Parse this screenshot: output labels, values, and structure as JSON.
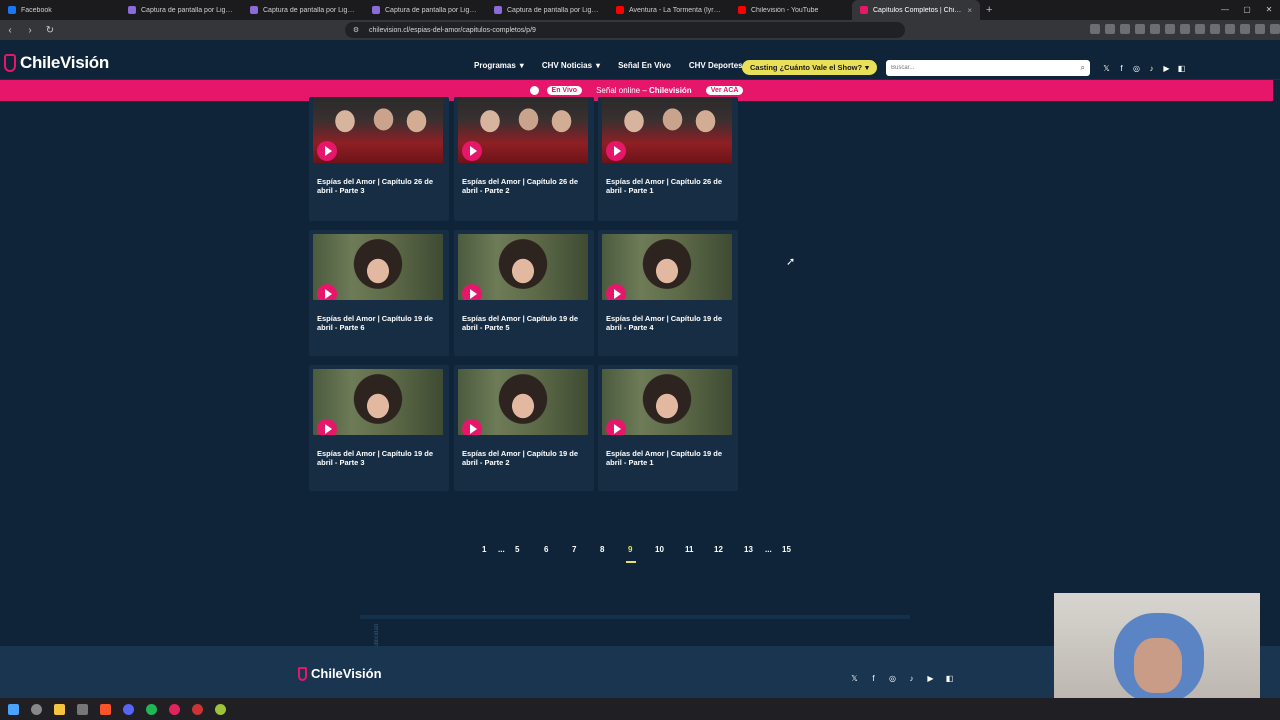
{
  "browser": {
    "tabs": [
      {
        "label": "Facebook",
        "color": "#1877f2",
        "active": false,
        "x": 0
      },
      {
        "label": "Captura de pantalla por Lightshot",
        "color": "#8a6bd8",
        "active": false
      },
      {
        "label": "Captura de pantalla por Lightshot",
        "color": "#8a6bd8",
        "active": false
      },
      {
        "label": "Captura de pantalla por Lightshot",
        "color": "#8a6bd8",
        "active": false
      },
      {
        "label": "Captura de pantalla por Lightshot",
        "color": "#8a6bd8",
        "active": false
      },
      {
        "label": "Aventura - La Tormenta (lyric - le",
        "color": "#ff0000",
        "active": false
      },
      {
        "label": "Chilevisión - YouTube",
        "color": "#ff0000",
        "active": false
      },
      {
        "label": "Capítulos Completos | Chilevisió",
        "color": "#e6176b",
        "active": true
      }
    ],
    "new_tab": "+",
    "url": "chilevision.cl/espias-del-amor/capitulos-completos/p/9"
  },
  "site": {
    "logo_text": "ChileVisión",
    "nav": [
      {
        "label": "Programas",
        "dropdown": true
      },
      {
        "label": "CHV Noticias",
        "dropdown": true
      },
      {
        "label": "Señal En Vivo",
        "dropdown": false
      },
      {
        "label": "CHV Deportes",
        "dropdown": false
      }
    ],
    "casting_label": "Casting ¿Cuánto Vale el Show?",
    "search_placeholder": "Buscar...",
    "social_icons": [
      "x-icon",
      "facebook-icon",
      "instagram-icon",
      "tiktok-icon",
      "youtube-icon",
      "twitch-icon"
    ]
  },
  "live_bar": {
    "badge": "En Vivo",
    "text": "Señal online – ",
    "channel": "Chilevisión",
    "cta": "Ver ACÁ"
  },
  "episodes": [
    {
      "title": "Espías del Amor | Capítulo 26 de abril - Parte 3",
      "thumb": "red"
    },
    {
      "title": "Espías del Amor | Capítulo 26 de abril - Parte 2",
      "thumb": "red"
    },
    {
      "title": "Espías del Amor | Capítulo 26 de abril - Parte 1",
      "thumb": "red"
    },
    {
      "title": "Espías del Amor | Capítulo 19 de abril - Parte 6",
      "thumb": "green"
    },
    {
      "title": "Espías del Amor | Capítulo 19 de abril - Parte 5",
      "thumb": "green"
    },
    {
      "title": "Espías del Amor | Capítulo 19 de abril - Parte 4",
      "thumb": "green"
    },
    {
      "title": "Espías del Amor | Capítulo 19 de abril - Parte 3",
      "thumb": "green"
    },
    {
      "title": "Espías del Amor | Capítulo 19 de abril - Parte 2",
      "thumb": "green"
    },
    {
      "title": "Espías del Amor | Capítulo 19 de abril - Parte 1",
      "thumb": "green"
    }
  ],
  "pagination": {
    "items": [
      "1",
      "...",
      "5",
      "6",
      "7",
      "8",
      "9",
      "10",
      "11",
      "12",
      "13",
      "...",
      "15"
    ],
    "current": "9"
  },
  "ad_label": "Publicidad",
  "footer": {
    "logo_text": "ChileVisión"
  },
  "colors": {
    "brand_pink": "#e6176b",
    "background": "#0f2438",
    "accent_yellow": "#e9e05a"
  }
}
